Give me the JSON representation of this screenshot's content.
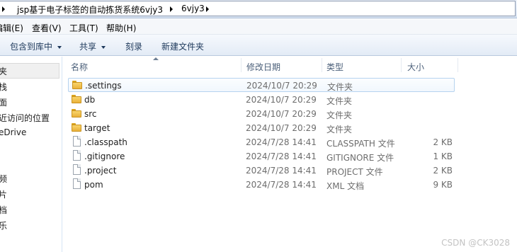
{
  "address": {
    "crumbs": [
      "jsp基于电子标签的自动拣货系统6vjy3",
      "6vjy3"
    ]
  },
  "menu": {
    "items": [
      "编辑(E)",
      "查看(V)",
      "工具(T)",
      "帮助(H)"
    ]
  },
  "toolbar": {
    "include_library": "包含到库中",
    "share": "共享",
    "burn": "刻录",
    "new_folder": "新建文件夹"
  },
  "nav": {
    "items": [
      "夹",
      "栈",
      "面",
      "近访问的位置",
      "eDrive",
      "",
      "",
      "",
      "频",
      "片",
      "档",
      "乐"
    ]
  },
  "columns": {
    "name": "名称",
    "modified": "修改日期",
    "type": "类型",
    "size": "大小"
  },
  "files": [
    {
      "name": ".settings",
      "modified": "2024/10/7 20:29",
      "type": "文件夹",
      "size": "",
      "icon": "folder-icon"
    },
    {
      "name": "db",
      "modified": "2024/10/7 20:29",
      "type": "文件夹",
      "size": "",
      "icon": "folder-icon"
    },
    {
      "name": "src",
      "modified": "2024/10/7 20:29",
      "type": "文件夹",
      "size": "",
      "icon": "folder-icon"
    },
    {
      "name": "target",
      "modified": "2024/10/7 20:29",
      "type": "文件夹",
      "size": "",
      "icon": "folder-icon"
    },
    {
      "name": ".classpath",
      "modified": "2024/7/28 14:41",
      "type": "CLASSPATH 文件",
      "size": "2 KB",
      "icon": "file-icon"
    },
    {
      "name": ".gitignore",
      "modified": "2024/7/28 14:41",
      "type": "GITIGNORE 文件",
      "size": "1 KB",
      "icon": "file-icon"
    },
    {
      "name": ".project",
      "modified": "2024/7/28 14:41",
      "type": "PROJECT 文件",
      "size": "2 KB",
      "icon": "file-icon"
    },
    {
      "name": "pom",
      "modified": "2024/7/28 14:41",
      "type": "XML 文档",
      "size": "9 KB",
      "icon": "file-icon"
    }
  ],
  "watermark": "CSDN @CK3028"
}
